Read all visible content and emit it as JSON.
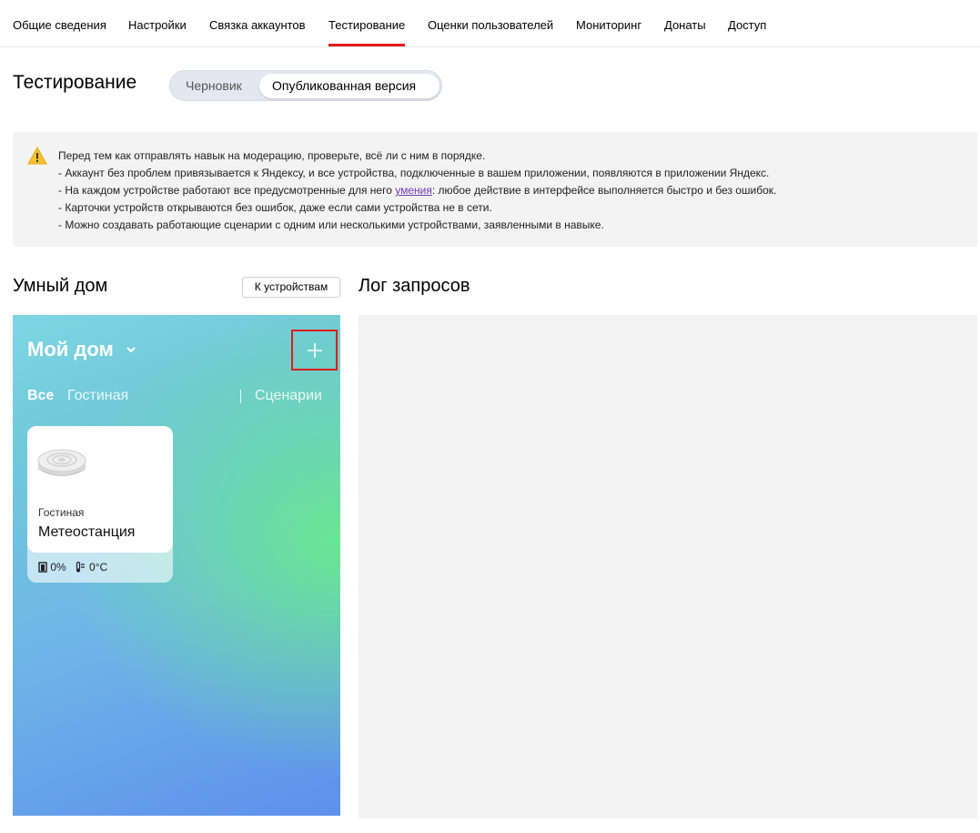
{
  "nav": {
    "tabs": [
      {
        "label": "Общие сведения"
      },
      {
        "label": "Настройки"
      },
      {
        "label": "Связка аккаунтов"
      },
      {
        "label": "Тестирование"
      },
      {
        "label": "Оценки пользователей"
      },
      {
        "label": "Мониторинг"
      },
      {
        "label": "Донаты"
      },
      {
        "label": "Доступ"
      }
    ],
    "active": "Тестирование"
  },
  "page": {
    "title": "Тестирование",
    "version_switch": {
      "draft": "Черновик",
      "published": "Опубликованная версия",
      "selected": "Опубликованная версия"
    }
  },
  "notice": {
    "intro": "Перед тем как отправлять навык на модерацию, проверьте, всё ли с ним в порядке.",
    "line1": "- Аккаунт без проблем привязывается к Яндексу, и все устройства, подключенные в вашем приложении, появляются в приложении Яндекс.",
    "line2_before": "- На каждом устройстве работают все предусмотренные для него ",
    "line2_link": "умения",
    "line2_after": ": любое действие в интерфейсе выполняется быстро и без ошибок.",
    "line3": "- Карточки устройств открываются без ошибок, даже если сами устройства не в сети.",
    "line4": "- Можно создавать работающие сценарии с одним или несколькими устройствами, заявленными в навыке.",
    "icon": "warning-icon",
    "link_color": "#6f3cb8"
  },
  "smart_home": {
    "title": "Умный дом",
    "to_devices_button": "К устройствам",
    "home_name": "Мой дом",
    "add_icon": "plus-icon",
    "rooms": [
      "Все",
      "Гостиная"
    ],
    "active_room": "Все",
    "scenarios": "Сценарии",
    "device": {
      "room": "Гостиная",
      "name": "Метеостанция",
      "humidity": "0%",
      "temperature": "0°C"
    }
  },
  "log": {
    "title": "Лог запросов"
  },
  "colors": {
    "accent": "#e01b1b",
    "panel_bg": "#f3f3f3"
  }
}
